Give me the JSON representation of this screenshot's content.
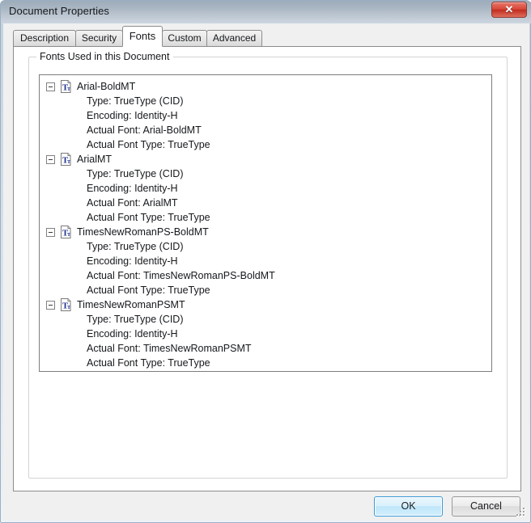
{
  "window": {
    "title": "Document Properties",
    "close_label": "✕"
  },
  "tabs": [
    {
      "label": "Description",
      "selected": false
    },
    {
      "label": "Security",
      "selected": false
    },
    {
      "label": "Fonts",
      "selected": true
    },
    {
      "label": "Custom",
      "selected": false
    },
    {
      "label": "Advanced",
      "selected": false
    }
  ],
  "groupbox": {
    "label": "Fonts Used in this Document"
  },
  "fonts": [
    {
      "name": "Arial-BoldMT",
      "icon": "truetype-font-icon",
      "expanded": true,
      "details": [
        "Type: TrueType (CID)",
        "Encoding: Identity-H",
        "Actual Font: Arial-BoldMT",
        "Actual Font Type: TrueType"
      ]
    },
    {
      "name": "ArialMT",
      "icon": "truetype-font-icon",
      "expanded": true,
      "details": [
        "Type: TrueType (CID)",
        "Encoding: Identity-H",
        "Actual Font: ArialMT",
        "Actual Font Type: TrueType"
      ]
    },
    {
      "name": "TimesNewRomanPS-BoldMT",
      "icon": "truetype-font-icon",
      "expanded": true,
      "details": [
        "Type: TrueType (CID)",
        "Encoding: Identity-H",
        "Actual Font: TimesNewRomanPS-BoldMT",
        "Actual Font Type: TrueType"
      ]
    },
    {
      "name": "TimesNewRomanPSMT",
      "icon": "truetype-font-icon",
      "expanded": true,
      "details": [
        "Type: TrueType (CID)",
        "Encoding: Identity-H",
        "Actual Font: TimesNewRomanPSMT",
        "Actual Font Type: TrueType"
      ]
    }
  ],
  "footer": {
    "ok_label": "OK",
    "cancel_label": "Cancel"
  },
  "colors": {
    "titlebar_top": "#9eabb9",
    "titlebar_bottom": "#cdd6e0",
    "close_red": "#c02d20",
    "default_button_border": "#3c9ad6",
    "dialog_background": "#f0f0f0",
    "panel_background": "#ffffff",
    "font_icon_letter": "#1b2f8f"
  }
}
